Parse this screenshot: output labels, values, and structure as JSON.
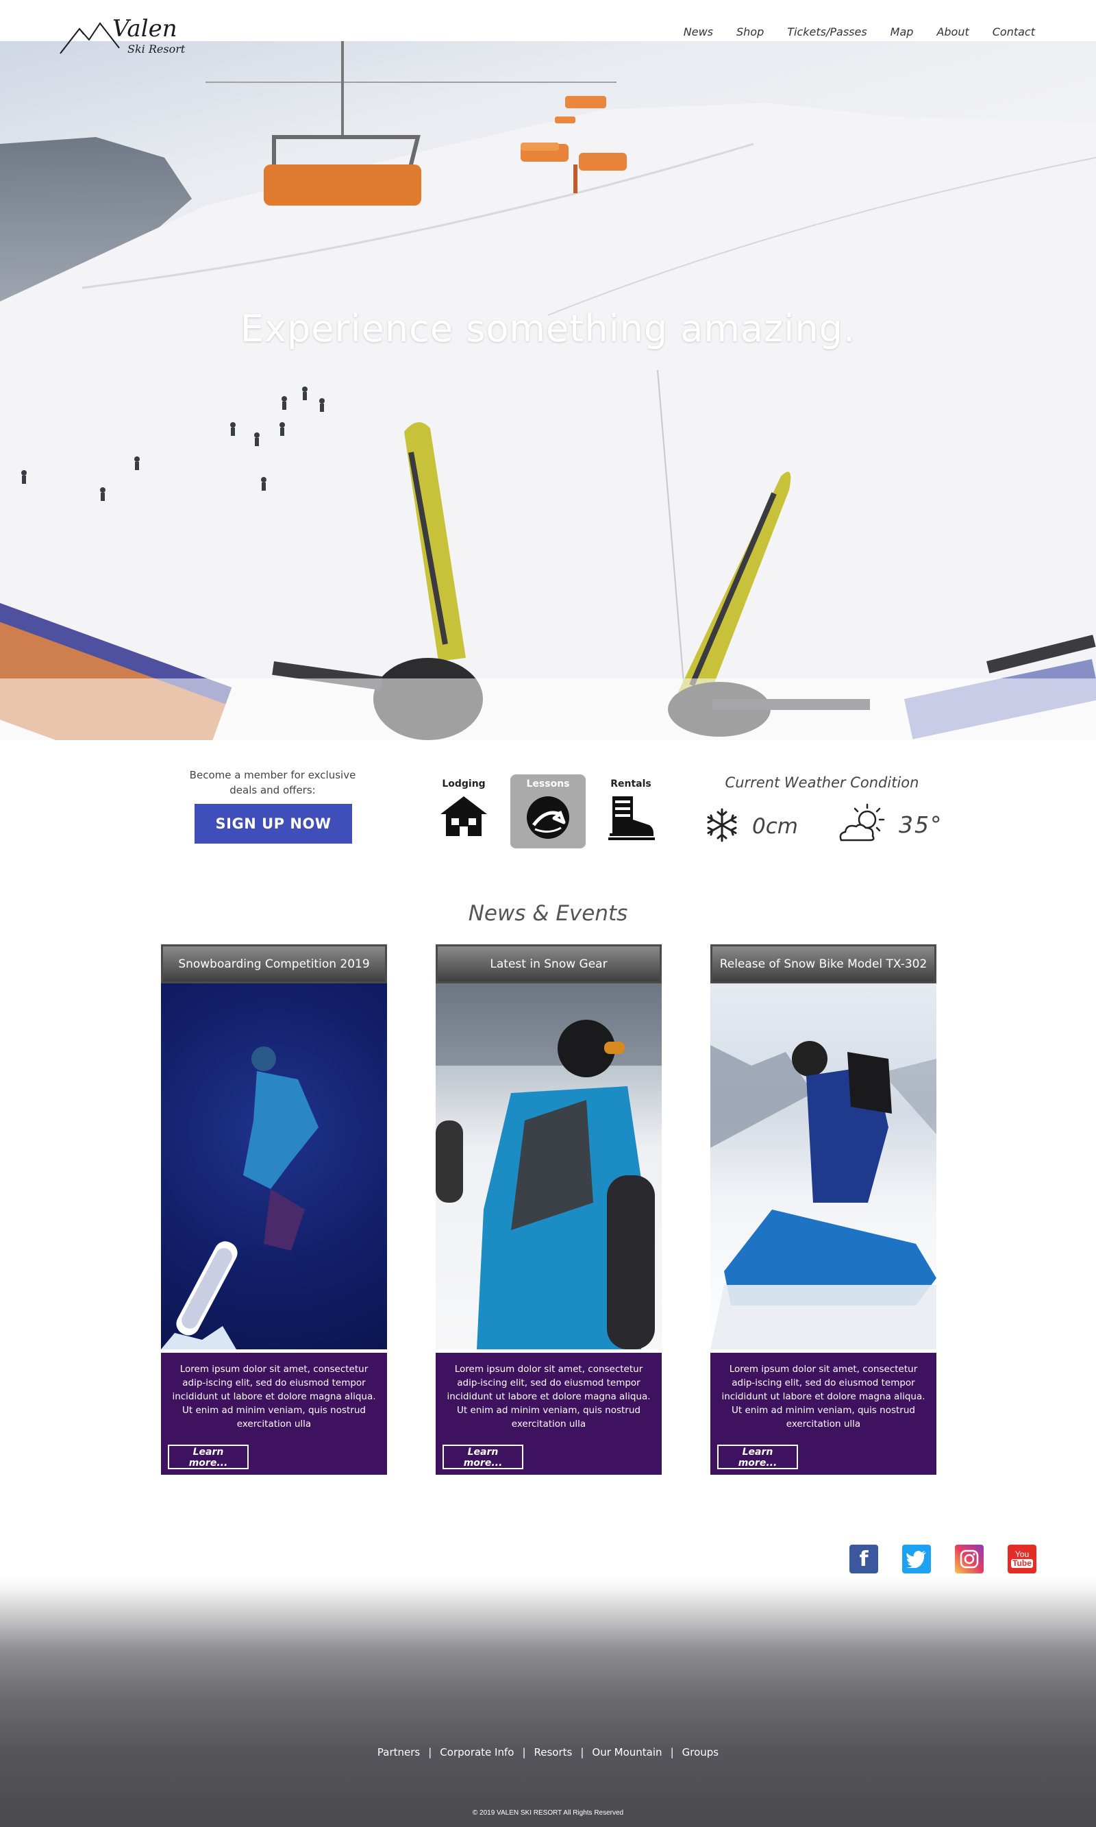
{
  "brand": {
    "name": "Valen",
    "subtitle": "Ski Resort"
  },
  "nav": [
    "News",
    "Shop",
    "Tickets/Passes",
    "Map",
    "About",
    "Contact"
  ],
  "hero": {
    "title": "Experience something amazing."
  },
  "membership": {
    "text": "Become a member for exclusive deals and offers:",
    "button": "SIGN UP NOW",
    "button_color": "#3f4eb8"
  },
  "services": [
    {
      "label": "Lodging",
      "icon": "lodge-icon",
      "active": false
    },
    {
      "label": "Lessons",
      "icon": "ski-trail-icon",
      "active": true
    },
    {
      "label": "Rentals",
      "icon": "ski-boot-icon",
      "active": false
    }
  ],
  "weather": {
    "title": "Current Weather Condition",
    "snow": "0cm",
    "snow_icon": "snowflake-icon",
    "temp": "35°",
    "temp_icon": "partly-cloudy-icon"
  },
  "news": {
    "title": "News & Events",
    "cards": [
      {
        "title": "Snowboarding Competition 2019",
        "text": "Lorem ipsum dolor sit amet, consectetur adip-iscing elit, sed do eiusmod tempor incididunt ut labore et dolore magna aliqua. Ut enim ad minim veniam, quis nostrud exercitation ulla",
        "button": "Learn more..."
      },
      {
        "title": "Latest in Snow Gear",
        "text": "Lorem ipsum dolor sit amet, consectetur adip-iscing elit, sed do eiusmod tempor incididunt ut labore et dolore magna aliqua. Ut enim ad minim veniam, quis nostrud exercitation ulla",
        "button": "Learn more..."
      },
      {
        "title": "Release of Snow Bike Model TX-302",
        "text": "Lorem ipsum dolor sit amet, consectetur adip-iscing elit, sed do eiusmod tempor incididunt ut labore et dolore magna aliqua. Ut enim ad minim veniam, quis nostrud exercitation ulla",
        "button": "Learn more..."
      }
    ],
    "card_body_color": "#3f1260"
  },
  "social": [
    {
      "name": "facebook-icon",
      "glyph": "f",
      "color": "#3b579d"
    },
    {
      "name": "twitter-icon",
      "glyph": "🐦",
      "color": "#1da1f2"
    },
    {
      "name": "instagram-icon",
      "glyph": "◎",
      "color": "#c13584"
    },
    {
      "name": "youtube-icon",
      "glyph": "You Tube",
      "color": "#e52d27"
    }
  ],
  "footer": {
    "links": [
      "Partners",
      "Corporate Info",
      "Resorts",
      "Our Mountain",
      "Groups"
    ],
    "copyright": "© 2019 VALEN SKI RESORT All Rights Reserved"
  }
}
